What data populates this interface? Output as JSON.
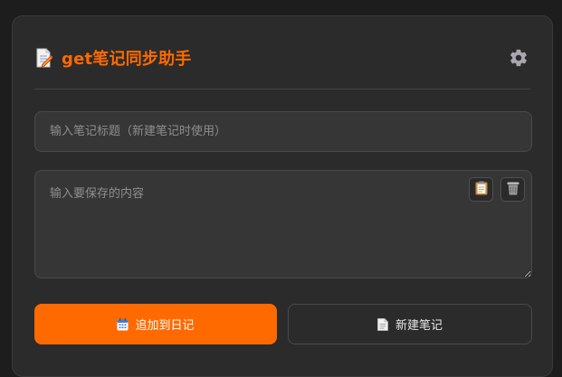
{
  "header": {
    "title": "get笔记同步助手",
    "title_icon": "memo-icon",
    "settings_icon": "gear-icon"
  },
  "form": {
    "title_placeholder": "输入笔记标题（新建笔记时使用）",
    "content_placeholder": "输入要保存的内容",
    "paste_icon": "clipboard-icon",
    "clear_icon": "wastebasket-icon"
  },
  "actions": {
    "append_label": "追加到日记",
    "append_icon": "calendar-icon",
    "new_label": "新建笔记",
    "new_icon": "document-icon"
  },
  "colors": {
    "accent": "#ff6a00",
    "panel": "#2b2b2b",
    "background": "#1d1d1d"
  }
}
